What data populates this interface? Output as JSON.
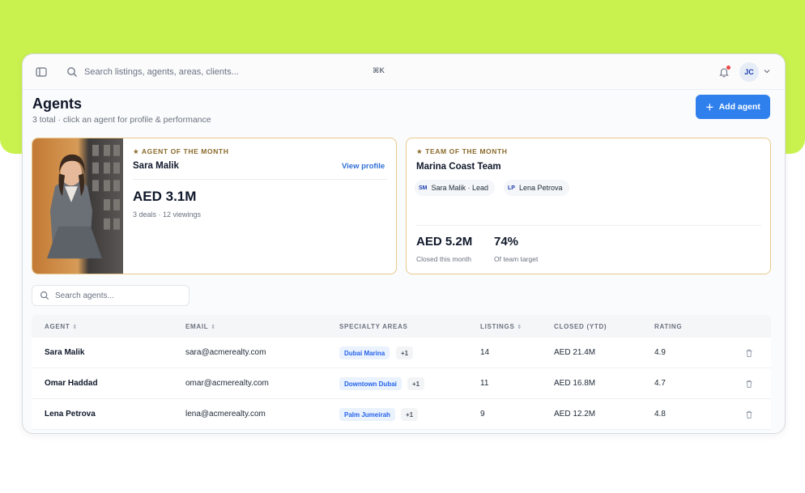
{
  "topbar": {
    "search_placeholder": "Search listings, agents, areas, clients...",
    "shortcut": "⌘K",
    "user_initials": "JC"
  },
  "page": {
    "title": "Agents",
    "subtitle": "3 total · click an agent for profile & performance",
    "add_button_label": "Add agent"
  },
  "agent_of_month": {
    "eyebrow": "★ AGENT OF THE MONTH",
    "name": "Sara Malik",
    "link": "View profile",
    "amount": "AED 3.1M",
    "meta": "3 deals · 12 viewings"
  },
  "team_of_month": {
    "eyebrow": "★ TEAM OF THE MONTH",
    "name": "Marina Coast Team",
    "members": [
      {
        "initials": "SM",
        "label": "Sara Malik · Lead"
      },
      {
        "initials": "LP",
        "label": "Lena Petrova"
      }
    ],
    "stats": [
      {
        "value": "AED 5.2M",
        "label": "Closed this month"
      },
      {
        "value": "74%",
        "label": "Of team target"
      }
    ]
  },
  "agent_search": {
    "placeholder": "Search agents..."
  },
  "table": {
    "headers": [
      "AGENT",
      "EMAIL",
      "SPECIALTY AREAS",
      "LISTINGS",
      "CLOSED (YTD)",
      "RATING"
    ],
    "rows": [
      {
        "name": "Sara Malik",
        "email": "sara@acmerealty.com",
        "area": "Dubai Marina",
        "extra": "+1",
        "listings": "14",
        "closed": "AED 21.4M",
        "rating": "4.9"
      },
      {
        "name": "Omar Haddad",
        "email": "omar@acmerealty.com",
        "area": "Downtown Dubai",
        "extra": "+1",
        "listings": "11",
        "closed": "AED 16.8M",
        "rating": "4.7"
      },
      {
        "name": "Lena Petrova",
        "email": "lena@acmerealty.com",
        "area": "Palm Jumeirah",
        "extra": "+1",
        "listings": "9",
        "closed": "AED 12.2M",
        "rating": "4.8"
      }
    ]
  },
  "colors": {
    "accent": "#2f80ed",
    "card_border": "#e8c98d",
    "backdrop": "#c9f24f"
  }
}
